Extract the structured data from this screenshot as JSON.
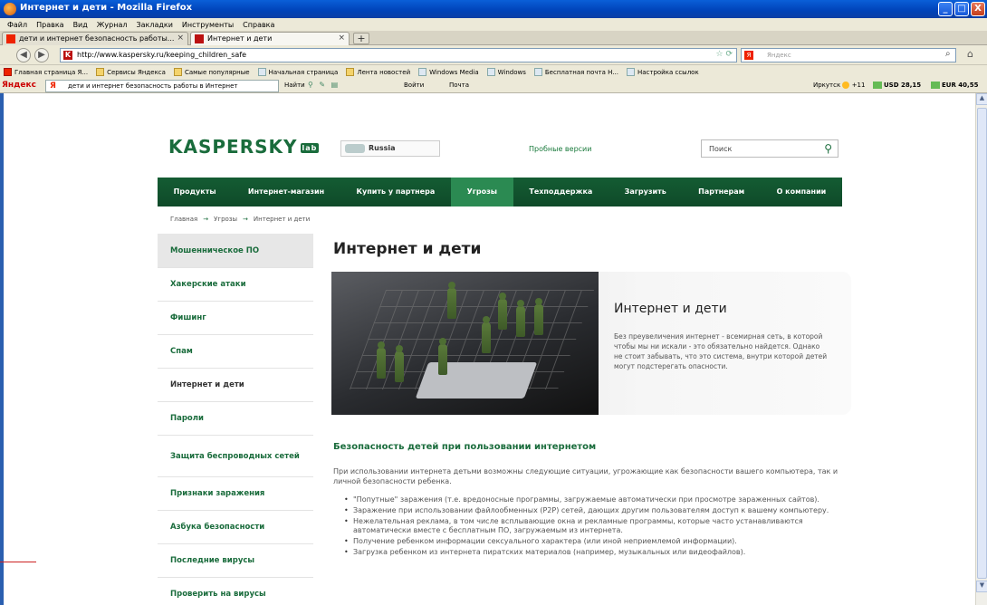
{
  "window": {
    "title": "Интернет и дети - Mozilla Firefox"
  },
  "menu": [
    "Файл",
    "Правка",
    "Вид",
    "Журнал",
    "Закладки",
    "Инструменты",
    "Справка"
  ],
  "tabs": [
    {
      "label": "дети и интернет безопасность работы..."
    },
    {
      "label": "Интернет и дети"
    }
  ],
  "nav": {
    "url": "http://www.kaspersky.ru/keeping_children_safe",
    "search_placeholder": "Яндекс"
  },
  "bookmarks": [
    "Главная страница Я...",
    "Сервисы Яндекса",
    "Самые популярные",
    "Начальная страница",
    "Лента новостей",
    "Windows Media",
    "Windows",
    "Бесплатная почта H...",
    "Настройка ссылок"
  ],
  "yandex_bar": {
    "logo": "Яндекс",
    "query": "дети и интернет безопасность работы в Интернет",
    "find": "Найти",
    "login": "Войти",
    "mail": "Почта",
    "weather": "Иркутск",
    "temp": "+11",
    "usd": "USD 28,15",
    "eur": "EUR 40,55"
  },
  "site": {
    "logo": "KASPERSKY",
    "logo_badge": "lab",
    "region": "Russia",
    "trials": "Пробные версии",
    "search_placeholder": "Поиск",
    "menu": [
      "Продукты",
      "Интернет-магазин",
      "Купить у партнера",
      "Угрозы",
      "Техподдержка",
      "Загрузить",
      "Партнерам",
      "О компании"
    ],
    "active_menu": "Угрозы",
    "breadcrumbs": [
      "Главная",
      "Угрозы",
      "Интернет и дети"
    ],
    "sidebar": [
      "Мошенническое ПО",
      "Хакерские атаки",
      "Фишинг",
      "Спам",
      "Интернет и дети",
      "Пароли",
      "Защита беспроводных сетей",
      "Признаки заражения",
      "Азбука безопасности",
      "Последние вирусы",
      "Проверить на вирусы"
    ],
    "page_title": "Интернет и дети",
    "hero_title": "Интернет и дети",
    "hero_text": "Без преувеличения интернет - всемирная сеть, в которой чтобы мы ни искали - это обязательно найдется. Однако не стоит забывать, что это система, внутри которой детей могут подстерегать опасности.",
    "section_title": "Безопасность детей при пользовании интернетом",
    "intro": "При использовании интернета детьми возможны следующие ситуации, угрожающие как безопасности вашего компьютера, так и личной безопасности ребенка.",
    "bullets": [
      "\"Попутные\" заражения (т.е. вредоносные программы, загружаемые автоматически при просмотре зараженных сайтов).",
      "Заражение при использовании файлообменных (P2P) сетей, дающих другим пользователям доступ к вашему компьютеру.",
      "Нежелательная реклама, в том числе всплывающие окна и рекламные программы, которые часто устанавливаются автоматически вместе с бесплатным ПО, загружаемым из интернета.",
      "Получение ребенком информации сексуального характера (или иной неприемлемой информации).",
      "Загрузка ребенком из интернета пиратских материалов (например, музыкальных или видеофайлов)."
    ]
  }
}
